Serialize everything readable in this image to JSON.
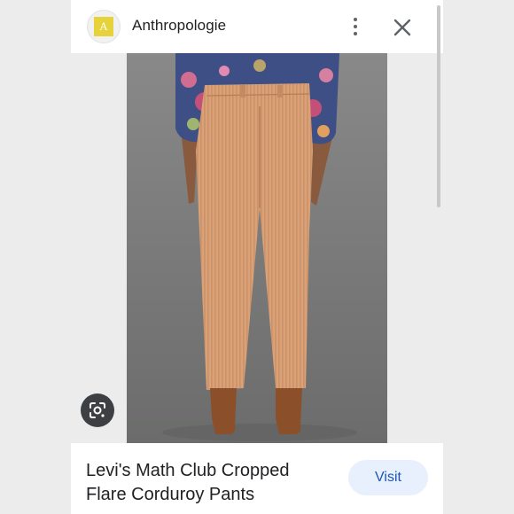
{
  "header": {
    "logo_letter": "A",
    "site_name": "Anthropologie",
    "more_icon": "more-vert-icon",
    "close_icon": "close-icon"
  },
  "image": {
    "alt": "Levi's Math Club Cropped Flare Corduroy Pants",
    "lens_icon": "google-lens-icon"
  },
  "product": {
    "title": "Levi's Math Club Cropped Flare Corduroy Pants",
    "visit_label": "Visit"
  },
  "colors": {
    "visit_bg": "#e8f0fe",
    "visit_text": "#1a56b8",
    "logo_bg": "#e6d23a"
  }
}
